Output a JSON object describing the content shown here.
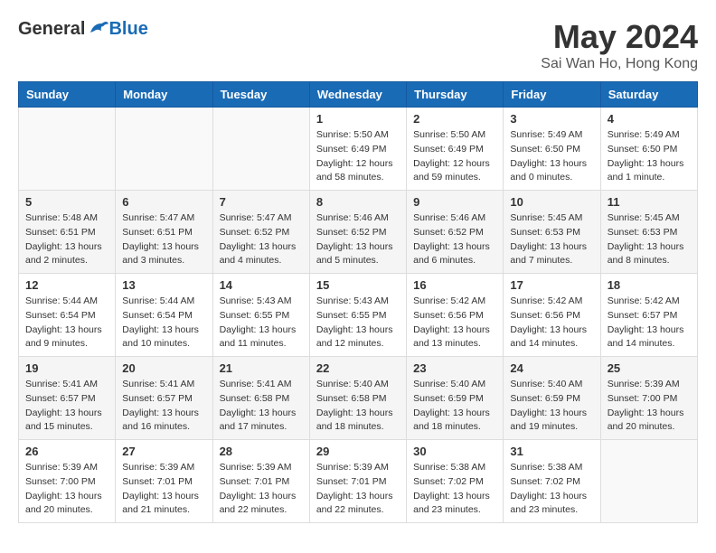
{
  "header": {
    "logo_general": "General",
    "logo_blue": "Blue",
    "month_title": "May 2024",
    "location": "Sai Wan Ho, Hong Kong"
  },
  "days_of_week": [
    "Sunday",
    "Monday",
    "Tuesday",
    "Wednesday",
    "Thursday",
    "Friday",
    "Saturday"
  ],
  "weeks": [
    [
      {
        "num": "",
        "info": ""
      },
      {
        "num": "",
        "info": ""
      },
      {
        "num": "",
        "info": ""
      },
      {
        "num": "1",
        "info": "Sunrise: 5:50 AM\nSunset: 6:49 PM\nDaylight: 12 hours\nand 58 minutes."
      },
      {
        "num": "2",
        "info": "Sunrise: 5:50 AM\nSunset: 6:49 PM\nDaylight: 12 hours\nand 59 minutes."
      },
      {
        "num": "3",
        "info": "Sunrise: 5:49 AM\nSunset: 6:50 PM\nDaylight: 13 hours\nand 0 minutes."
      },
      {
        "num": "4",
        "info": "Sunrise: 5:49 AM\nSunset: 6:50 PM\nDaylight: 13 hours\nand 1 minute."
      }
    ],
    [
      {
        "num": "5",
        "info": "Sunrise: 5:48 AM\nSunset: 6:51 PM\nDaylight: 13 hours\nand 2 minutes."
      },
      {
        "num": "6",
        "info": "Sunrise: 5:47 AM\nSunset: 6:51 PM\nDaylight: 13 hours\nand 3 minutes."
      },
      {
        "num": "7",
        "info": "Sunrise: 5:47 AM\nSunset: 6:52 PM\nDaylight: 13 hours\nand 4 minutes."
      },
      {
        "num": "8",
        "info": "Sunrise: 5:46 AM\nSunset: 6:52 PM\nDaylight: 13 hours\nand 5 minutes."
      },
      {
        "num": "9",
        "info": "Sunrise: 5:46 AM\nSunset: 6:52 PM\nDaylight: 13 hours\nand 6 minutes."
      },
      {
        "num": "10",
        "info": "Sunrise: 5:45 AM\nSunset: 6:53 PM\nDaylight: 13 hours\nand 7 minutes."
      },
      {
        "num": "11",
        "info": "Sunrise: 5:45 AM\nSunset: 6:53 PM\nDaylight: 13 hours\nand 8 minutes."
      }
    ],
    [
      {
        "num": "12",
        "info": "Sunrise: 5:44 AM\nSunset: 6:54 PM\nDaylight: 13 hours\nand 9 minutes."
      },
      {
        "num": "13",
        "info": "Sunrise: 5:44 AM\nSunset: 6:54 PM\nDaylight: 13 hours\nand 10 minutes."
      },
      {
        "num": "14",
        "info": "Sunrise: 5:43 AM\nSunset: 6:55 PM\nDaylight: 13 hours\nand 11 minutes."
      },
      {
        "num": "15",
        "info": "Sunrise: 5:43 AM\nSunset: 6:55 PM\nDaylight: 13 hours\nand 12 minutes."
      },
      {
        "num": "16",
        "info": "Sunrise: 5:42 AM\nSunset: 6:56 PM\nDaylight: 13 hours\nand 13 minutes."
      },
      {
        "num": "17",
        "info": "Sunrise: 5:42 AM\nSunset: 6:56 PM\nDaylight: 13 hours\nand 14 minutes."
      },
      {
        "num": "18",
        "info": "Sunrise: 5:42 AM\nSunset: 6:57 PM\nDaylight: 13 hours\nand 14 minutes."
      }
    ],
    [
      {
        "num": "19",
        "info": "Sunrise: 5:41 AM\nSunset: 6:57 PM\nDaylight: 13 hours\nand 15 minutes."
      },
      {
        "num": "20",
        "info": "Sunrise: 5:41 AM\nSunset: 6:57 PM\nDaylight: 13 hours\nand 16 minutes."
      },
      {
        "num": "21",
        "info": "Sunrise: 5:41 AM\nSunset: 6:58 PM\nDaylight: 13 hours\nand 17 minutes."
      },
      {
        "num": "22",
        "info": "Sunrise: 5:40 AM\nSunset: 6:58 PM\nDaylight: 13 hours\nand 18 minutes."
      },
      {
        "num": "23",
        "info": "Sunrise: 5:40 AM\nSunset: 6:59 PM\nDaylight: 13 hours\nand 18 minutes."
      },
      {
        "num": "24",
        "info": "Sunrise: 5:40 AM\nSunset: 6:59 PM\nDaylight: 13 hours\nand 19 minutes."
      },
      {
        "num": "25",
        "info": "Sunrise: 5:39 AM\nSunset: 7:00 PM\nDaylight: 13 hours\nand 20 minutes."
      }
    ],
    [
      {
        "num": "26",
        "info": "Sunrise: 5:39 AM\nSunset: 7:00 PM\nDaylight: 13 hours\nand 20 minutes."
      },
      {
        "num": "27",
        "info": "Sunrise: 5:39 AM\nSunset: 7:01 PM\nDaylight: 13 hours\nand 21 minutes."
      },
      {
        "num": "28",
        "info": "Sunrise: 5:39 AM\nSunset: 7:01 PM\nDaylight: 13 hours\nand 22 minutes."
      },
      {
        "num": "29",
        "info": "Sunrise: 5:39 AM\nSunset: 7:01 PM\nDaylight: 13 hours\nand 22 minutes."
      },
      {
        "num": "30",
        "info": "Sunrise: 5:38 AM\nSunset: 7:02 PM\nDaylight: 13 hours\nand 23 minutes."
      },
      {
        "num": "31",
        "info": "Sunrise: 5:38 AM\nSunset: 7:02 PM\nDaylight: 13 hours\nand 23 minutes."
      },
      {
        "num": "",
        "info": ""
      }
    ]
  ]
}
